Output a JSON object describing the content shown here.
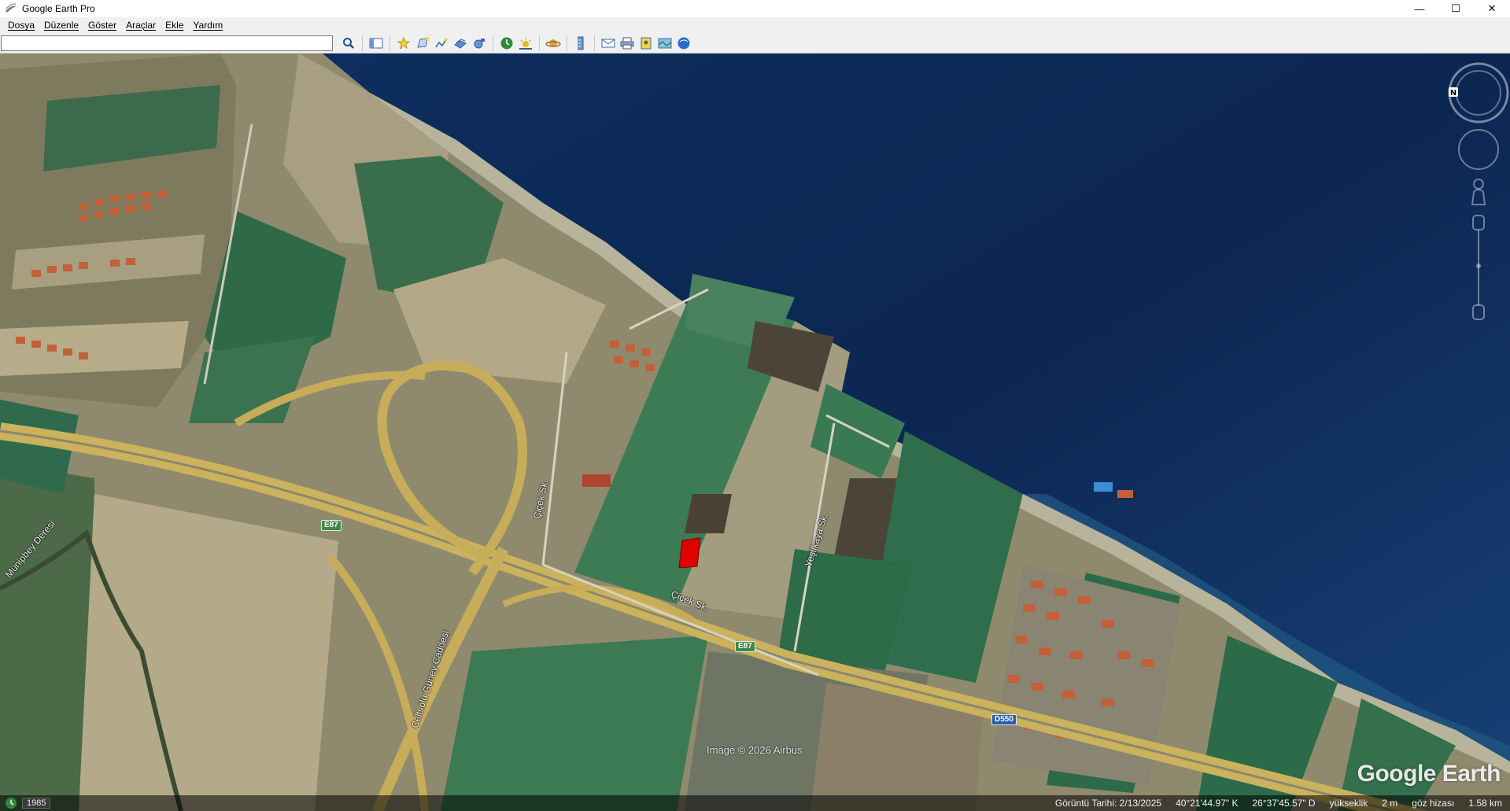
{
  "window": {
    "title": "Google Earth Pro",
    "minimize": "—",
    "maximize": "☐",
    "close": "✕"
  },
  "menu": [
    {
      "label": "Dosya"
    },
    {
      "label": "Düzenle"
    },
    {
      "label": "Göster"
    },
    {
      "label": "Araçlar"
    },
    {
      "label": "Ekle"
    },
    {
      "label": "Yardım"
    }
  ],
  "search": {
    "value": "",
    "placeholder": ""
  },
  "toolbar_icons": [
    "search-icon",
    "sidebar-toggle-icon",
    "placemark-icon",
    "polygon-icon",
    "path-icon",
    "image-overlay-icon",
    "tour-record-icon",
    "historical-imagery-icon",
    "sunlight-icon",
    "planets-icon",
    "ruler-icon",
    "email-icon",
    "print-icon",
    "save-image-icon",
    "map-view-icon",
    "web-globe-icon"
  ],
  "map": {
    "labels": {
      "street_cicek_1": "Çiçek Sk.",
      "street_cicek_2": "Çiçek Sk.",
      "street_yesilkaya": "Yeşilkaya Sk.",
      "stream_munipbey": "Münipbey Deresi",
      "road_celtiksu": "Celtsolu Güney Caddesi"
    },
    "shields": {
      "e87_a": "E87",
      "e87_b": "E87",
      "d550": "D550"
    },
    "imagery_credit": "Image © 2026 Airbus",
    "watermark": "Google Earth",
    "colors": {
      "sea_deep": "#0c2652",
      "sea_shallow": "#1c4f7a",
      "field_green": "#2f6a4c",
      "field_tan": "#b9ad8a",
      "road_yellow": "#d9b54a",
      "highlight_red": "#e00000"
    }
  },
  "status": {
    "history_year": "1985",
    "imagery_date": "Görüntü Tarihi: 2/13/2025",
    "lat": "40°21'44.97\" K",
    "lon": "26°37'45.57\" D",
    "elevation_label": "yükseklik",
    "elevation_value": "2 m",
    "eye_label": "göz hizası",
    "eye_value": "1.58 km"
  }
}
